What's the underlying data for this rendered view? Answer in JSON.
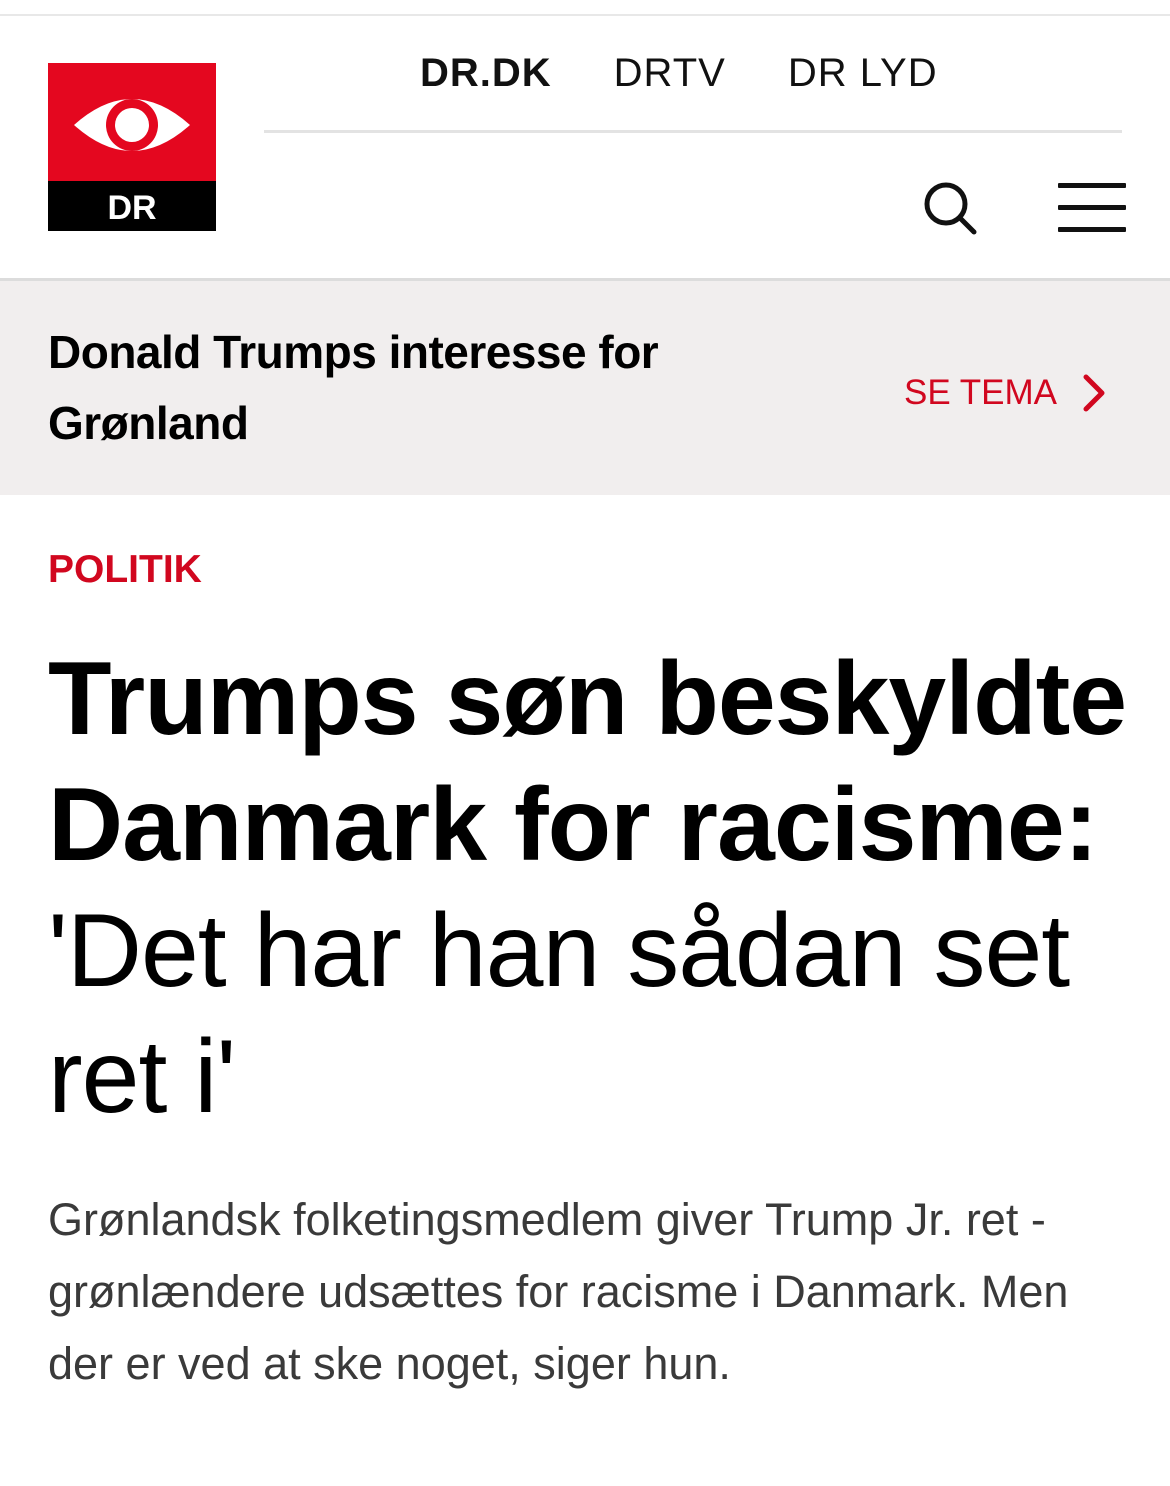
{
  "nav": {
    "items": [
      {
        "label": "DR.DK",
        "active": true
      },
      {
        "label": "DRTV",
        "active": false
      },
      {
        "label": "DR LYD",
        "active": false
      }
    ]
  },
  "logo": {
    "text": "DR",
    "color": "#e4071f"
  },
  "icons": {
    "search": "search-icon",
    "menu": "hamburger-menu-icon",
    "chevron": "chevron-right-icon"
  },
  "theme": {
    "title": "Donald Trumps interesse for Grønland",
    "link_label": "SE TEMA",
    "background": "#f1eeee"
  },
  "article": {
    "category": "POLITIK",
    "headline_strong": "Trumps søn beskyldte Danmark for racisme:",
    "headline_quote": "'Det har han sådan set ret i'",
    "summary": "Grønlandsk folketingsmedlem giver Trump Jr. ret - grønlændere udsættes for racisme i Danmark. Men der er ved at ske noget, siger hun."
  },
  "colors": {
    "accent": "#d1071f",
    "text": "#000000",
    "summary_text": "#3a3a3a"
  }
}
